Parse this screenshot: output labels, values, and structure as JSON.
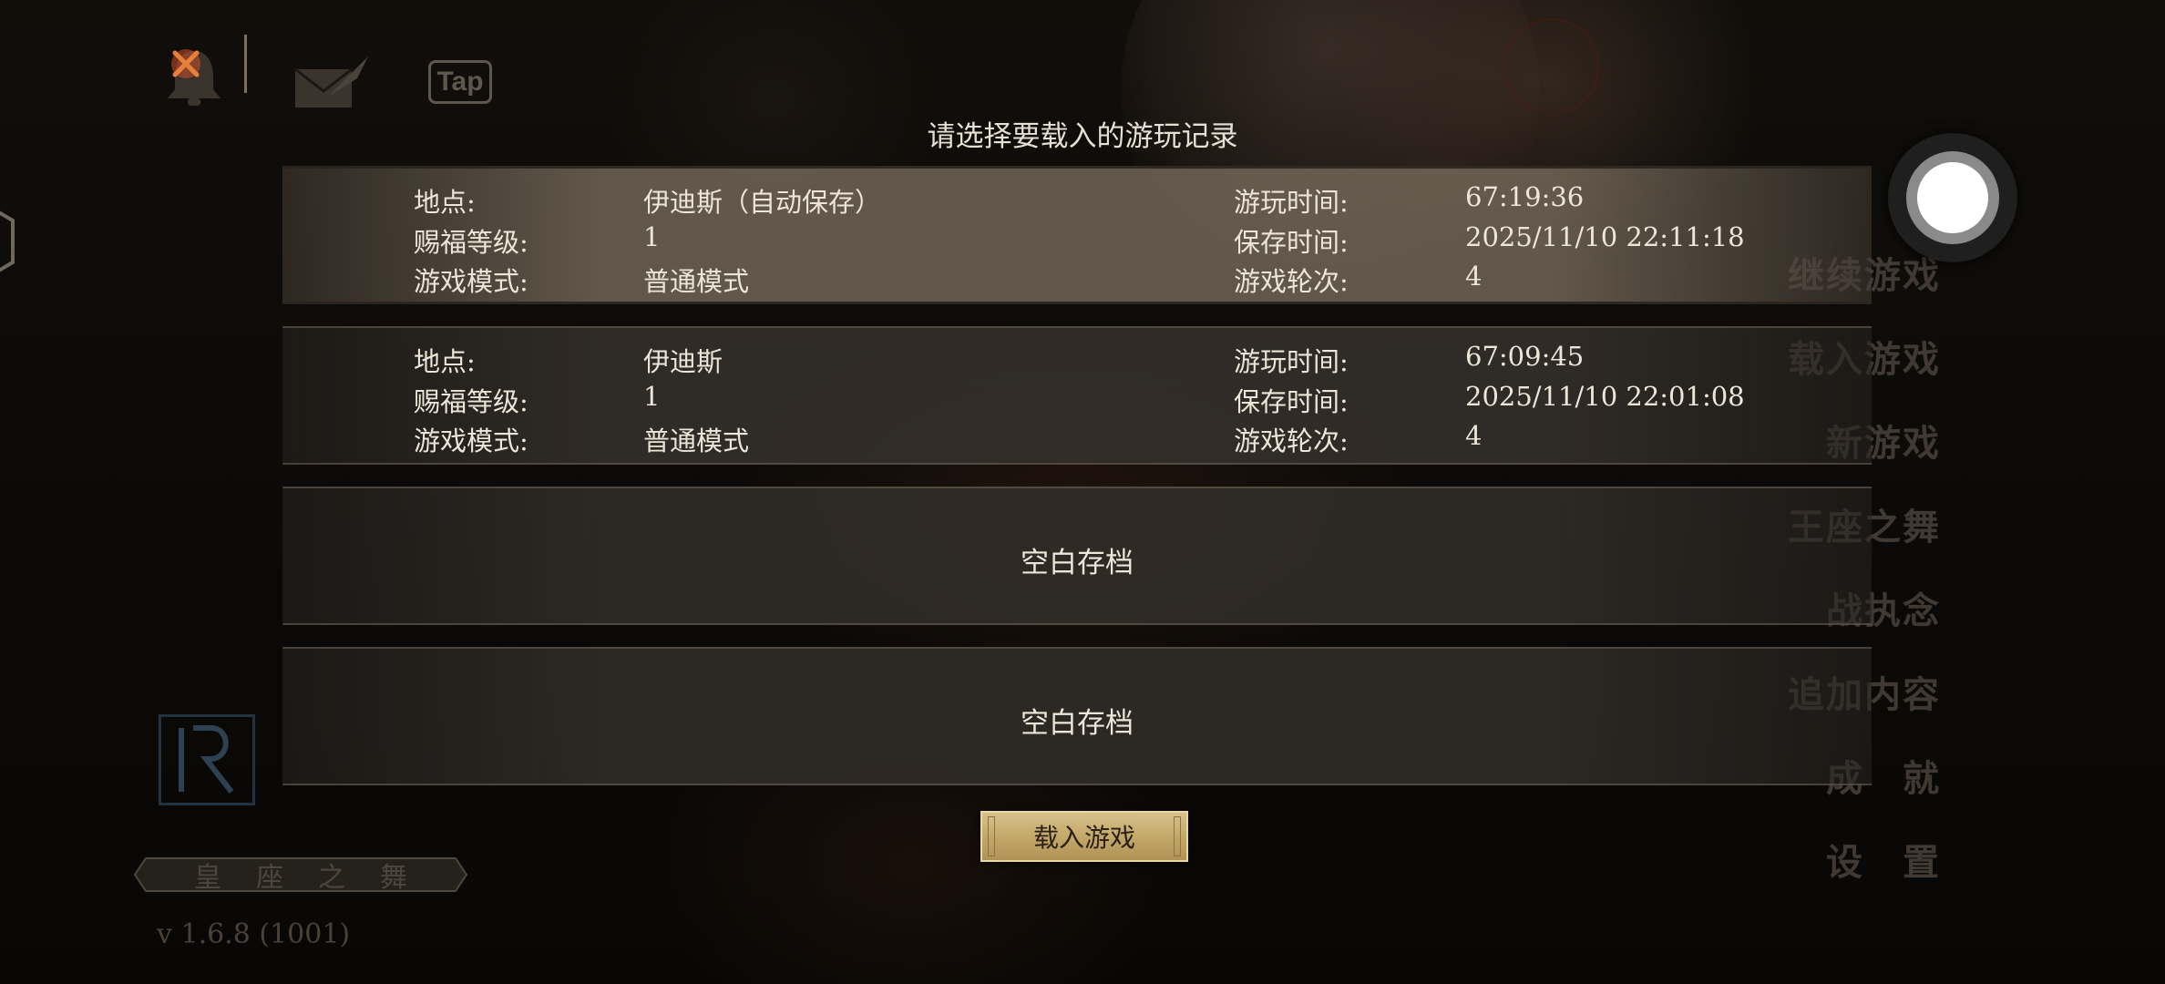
{
  "top_icons": {
    "bell": "bell-icon",
    "mail": "mail-icon",
    "tap": "Tap"
  },
  "dialog": {
    "title": "请选择要载入的游玩记录",
    "slots": [
      {
        "location_label": "地点:",
        "location": "伊迪斯（自动保存）",
        "level_label": "赐福等级:",
        "level": "1",
        "mode_label": "游戏模式:",
        "mode": "普通模式",
        "playtime_label": "游玩时间:",
        "playtime": "67:19:36",
        "savetime_label": "保存时间:",
        "savetime": "2025/11/10 22:11:18",
        "round_label": "游戏轮次:",
        "round": "4"
      },
      {
        "location_label": "地点:",
        "location": "伊迪斯",
        "level_label": "赐福等级:",
        "level": "1",
        "mode_label": "游戏模式:",
        "mode": "普通模式",
        "playtime_label": "游玩时间:",
        "playtime": "67:09:45",
        "savetime_label": "保存时间:",
        "savetime": "2025/11/10 22:01:08",
        "round_label": "游戏轮次:",
        "round": "4"
      },
      {
        "empty_label": "空白存档"
      },
      {
        "empty_label": "空白存档"
      }
    ],
    "load_button": "载入游戏"
  },
  "menu": {
    "items": [
      "继续游戏",
      "载入游戏",
      "新游戏",
      "王座之舞",
      "战执念",
      "追加内容",
      "成　就",
      "设　置"
    ]
  },
  "branding": {
    "logo_letter": "R",
    "game_title": "皇座之舞",
    "version": "v 1.6.8 (1001)"
  },
  "colors": {
    "accent_gold": "#c2a668",
    "selected_slot": "#786c5c",
    "text": "#ece6d8"
  }
}
